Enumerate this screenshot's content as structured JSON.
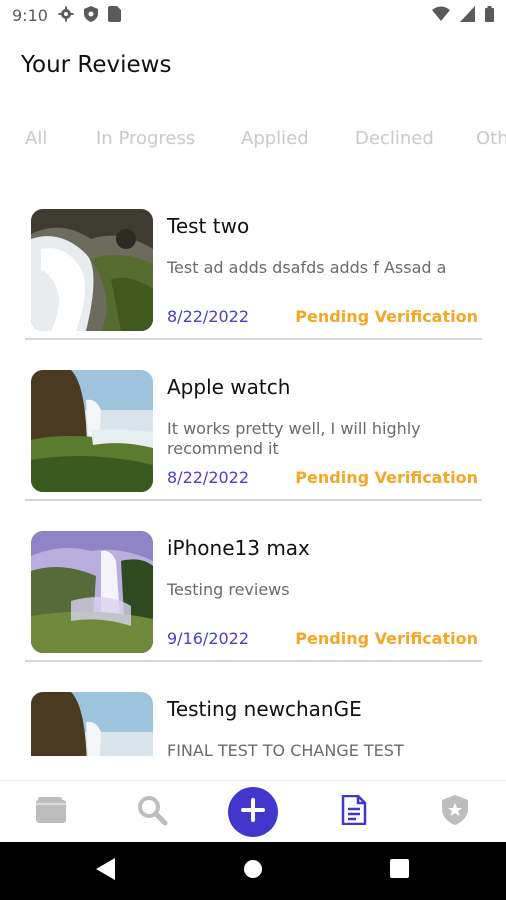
{
  "status_bar": {
    "time": "9:10",
    "icons_left": [
      "gear-icon",
      "shield-icon",
      "sim-card-icon"
    ],
    "icons_right": [
      "wifi-icon",
      "signal-icon",
      "battery-icon"
    ]
  },
  "header": {
    "title": "Your Reviews"
  },
  "tabs": [
    {
      "label": "All"
    },
    {
      "label": "In Progress"
    },
    {
      "label": "Applied"
    },
    {
      "label": "Declined"
    },
    {
      "label": "Oth"
    }
  ],
  "reviews": [
    {
      "title": "Test two",
      "description": "Test ad adds dsafds adds f Assad a",
      "date": "8/22/2022",
      "status": "Pending Verification",
      "image": "waterfall-rocks"
    },
    {
      "title": "Apple watch",
      "description": "It works pretty well, I will highly recommend it",
      "date": "8/22/2022",
      "status": "Pending Verification",
      "image": "waterfall-cliff"
    },
    {
      "title": "iPhone13 max",
      "description": "Testing reviews",
      "date": "9/16/2022",
      "status": "Pending Verification",
      "image": "waterfall-misty"
    },
    {
      "title": "Testing newchanGE",
      "description": "FINAL TEST  TO CHANGE TEST",
      "date": "",
      "status": "",
      "image": "waterfall-cliff"
    }
  ],
  "bottom_nav": [
    {
      "icon": "wallet-icon",
      "active": false
    },
    {
      "icon": "search-icon",
      "active": false
    },
    {
      "icon": "add-icon",
      "active": false
    },
    {
      "icon": "document-icon",
      "active": true
    },
    {
      "icon": "shield-star-icon",
      "active": false
    }
  ],
  "colors": {
    "accent": "#4137cc",
    "date": "#4a3fd1",
    "status": "#f5a623",
    "tab_inactive": "#c9c9c9",
    "divider": "#d5d5d5"
  }
}
